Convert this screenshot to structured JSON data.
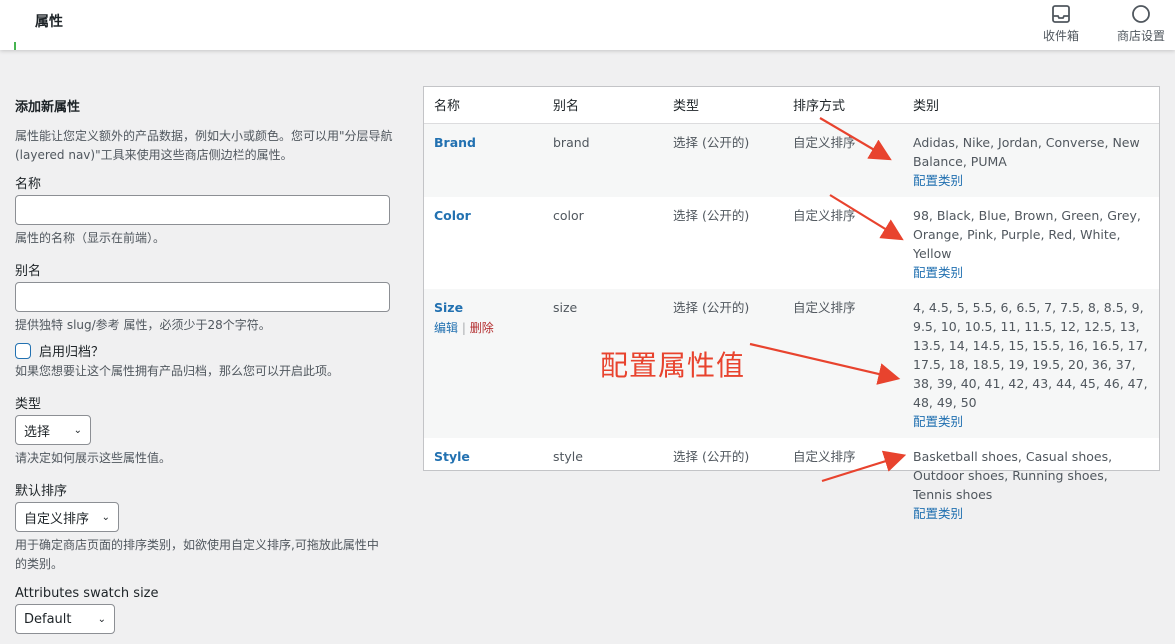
{
  "header": {
    "title": "属性",
    "actions": [
      {
        "label": "收件箱",
        "icon": "inbox-icon"
      },
      {
        "label": "商店设置",
        "icon": "circle-icon"
      }
    ]
  },
  "form": {
    "heading": "添加新属性",
    "intro": "属性能让您定义额外的产品数据，例如大小或颜色。您可以用\"分层导航(layered nav)\"工具来使用这些商店侧边栏的属性。",
    "name_label": "名称",
    "name_value": "",
    "name_help": "属性的名称（显示在前端）。",
    "slug_label": "别名",
    "slug_value": "",
    "slug_help": "提供独特 slug/参考 属性，必须少于28个字符。",
    "archive_label": "启用归档？",
    "archive_help": "如果您想要让这个属性拥有产品归档，那么您可以开启此项。",
    "type_label": "类型",
    "type_value": "选择",
    "type_help": "请决定如何展示这些属性值。",
    "sort_label": "默认排序",
    "sort_value": "自定义排序",
    "sort_help": "用于确定商店页面的排序类别，如欲使用自定义排序,可拖放此属性中的类别。",
    "swatch_label": "Attributes swatch size",
    "swatch_value": "Default"
  },
  "table": {
    "columns": [
      "名称",
      "别名",
      "类型",
      "排序方式",
      "类别"
    ],
    "rows": [
      {
        "name": "Brand",
        "slug": "brand",
        "type": "选择 (公开的)",
        "order": "自定义排序",
        "terms": "Adidas, Nike, Jordan, Converse, New Balance, PUMA",
        "config": "配置类别"
      },
      {
        "name": "Color",
        "slug": "color",
        "type": "选择 (公开的)",
        "order": "自定义排序",
        "terms": "98, Black, Blue, Brown, Green, Grey, Orange, Pink, Purple, Red, White, Yellow",
        "config": "配置类别"
      },
      {
        "name": "Size",
        "slug": "size",
        "type": "选择 (公开的)",
        "order": "自定义排序",
        "terms": "4, 4.5, 5, 5.5, 6, 6.5, 7, 7.5, 8, 8.5, 9, 9.5, 10, 10.5, 11, 11.5, 12, 12.5, 13, 13.5, 14, 14.5, 15, 15.5, 16, 16.5, 17, 17.5, 18, 18.5, 19, 19.5, 20, 36, 37, 38, 39, 40, 41, 42, 43, 44, 45, 46, 47, 48, 49, 50",
        "config": "配置类别",
        "edit": "编辑",
        "delete": "删除",
        "sep": "|"
      },
      {
        "name": "Style",
        "slug": "style",
        "type": "选择 (公开的)",
        "order": "自定义排序",
        "terms": "Basketball shoes, Casual shoes, Outdoor shoes, Running shoes, Tennis shoes",
        "config": "配置类别"
      }
    ]
  },
  "annotation": {
    "text": "配置属性值",
    "color": "#e8432e"
  }
}
